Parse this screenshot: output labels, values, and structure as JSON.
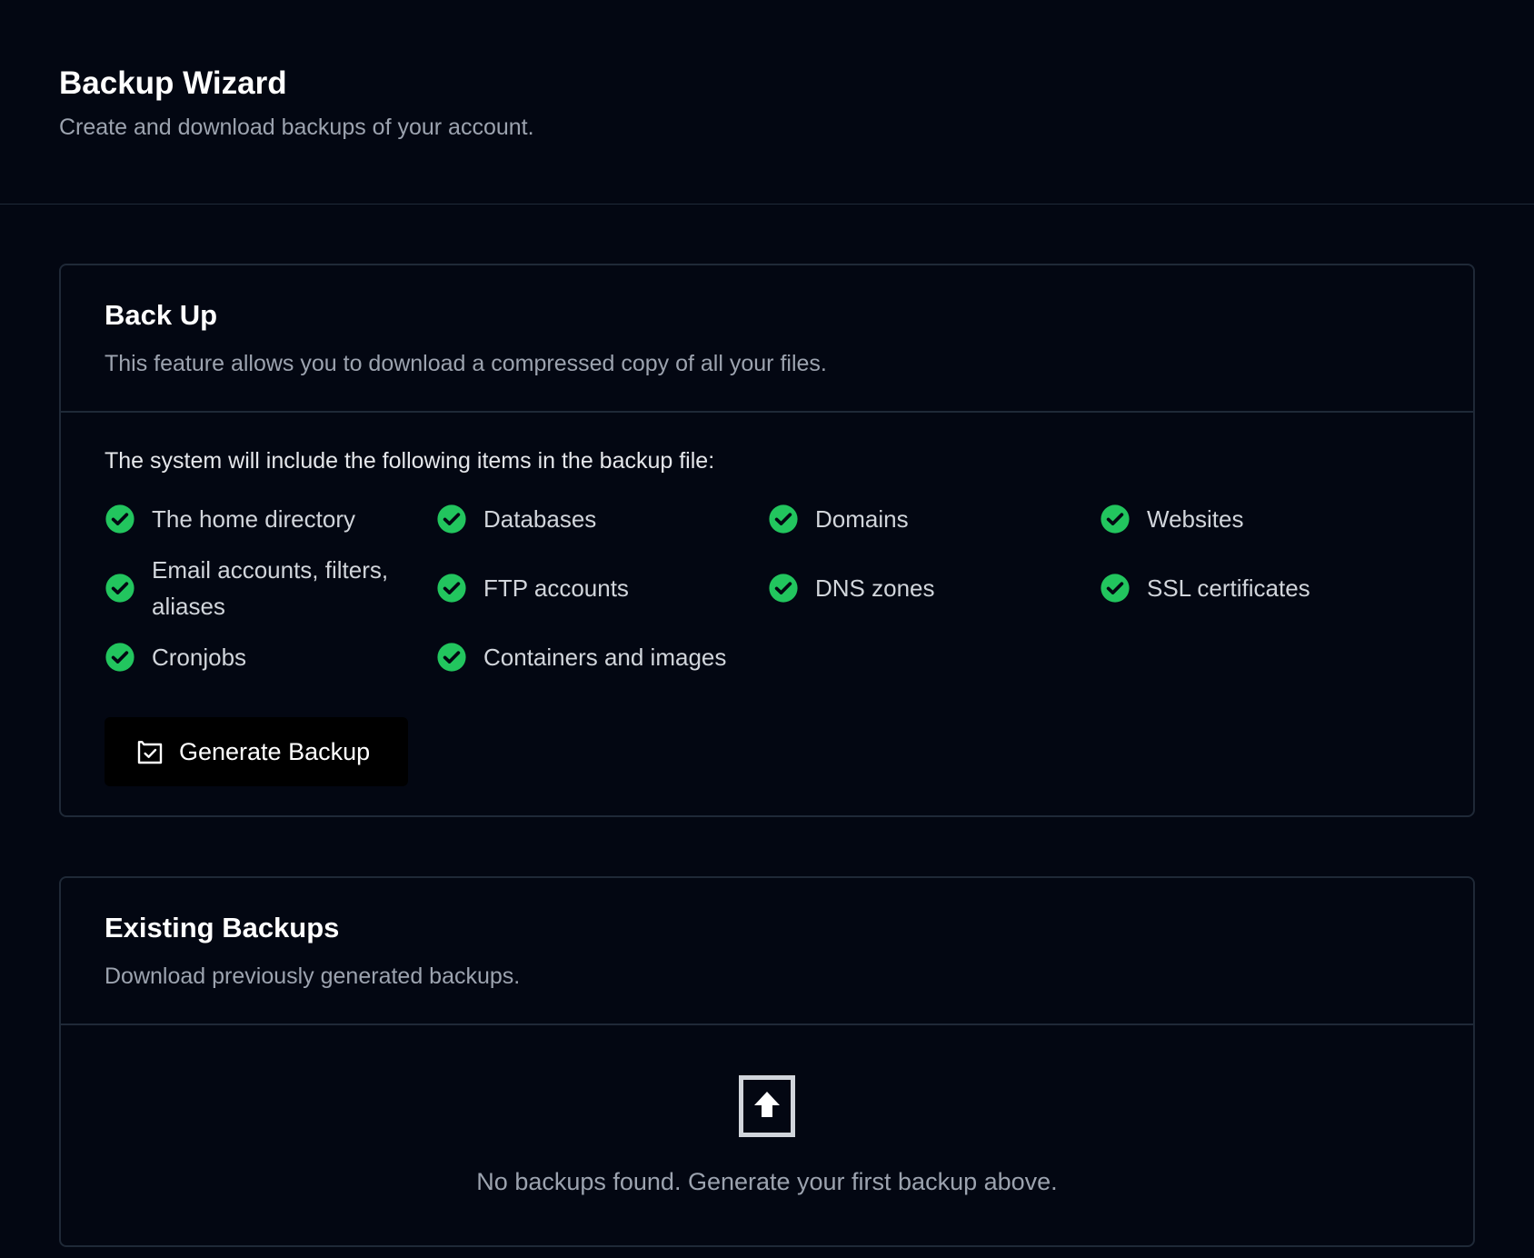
{
  "header": {
    "title": "Backup Wizard",
    "subtitle": "Create and download backups of your account."
  },
  "backup_card": {
    "title": "Back Up",
    "description": "This feature allows you to download a compressed copy of all your files.",
    "intro": "The system will include the following items in the backup file:",
    "items": [
      {
        "label": "The home directory",
        "icon": "check-circle-icon"
      },
      {
        "label": "Databases",
        "icon": "check-circle-icon"
      },
      {
        "label": "Domains",
        "icon": "check-circle-icon"
      },
      {
        "label": "Websites",
        "icon": "check-circle-icon"
      },
      {
        "label": "Email accounts, filters, aliases",
        "icon": "check-circle-icon"
      },
      {
        "label": "FTP accounts",
        "icon": "check-circle-icon"
      },
      {
        "label": "DNS zones",
        "icon": "check-circle-icon"
      },
      {
        "label": "SSL certificates",
        "icon": "check-circle-icon"
      },
      {
        "label": "Cronjobs",
        "icon": "check-circle-icon"
      },
      {
        "label": "Containers and images",
        "icon": "check-circle-icon"
      }
    ],
    "generate_button_label": "Generate Backup",
    "generate_button_icon": "archive-check-icon"
  },
  "existing_card": {
    "title": "Existing Backups",
    "description": "Download previously generated backups.",
    "empty_icon": "upload-box-icon",
    "empty_text": "No backups found. Generate your first backup above."
  },
  "colors": {
    "background": "#030712",
    "border": "#1f2937",
    "check": "#22c55e",
    "muted_text": "#9ca3af"
  }
}
